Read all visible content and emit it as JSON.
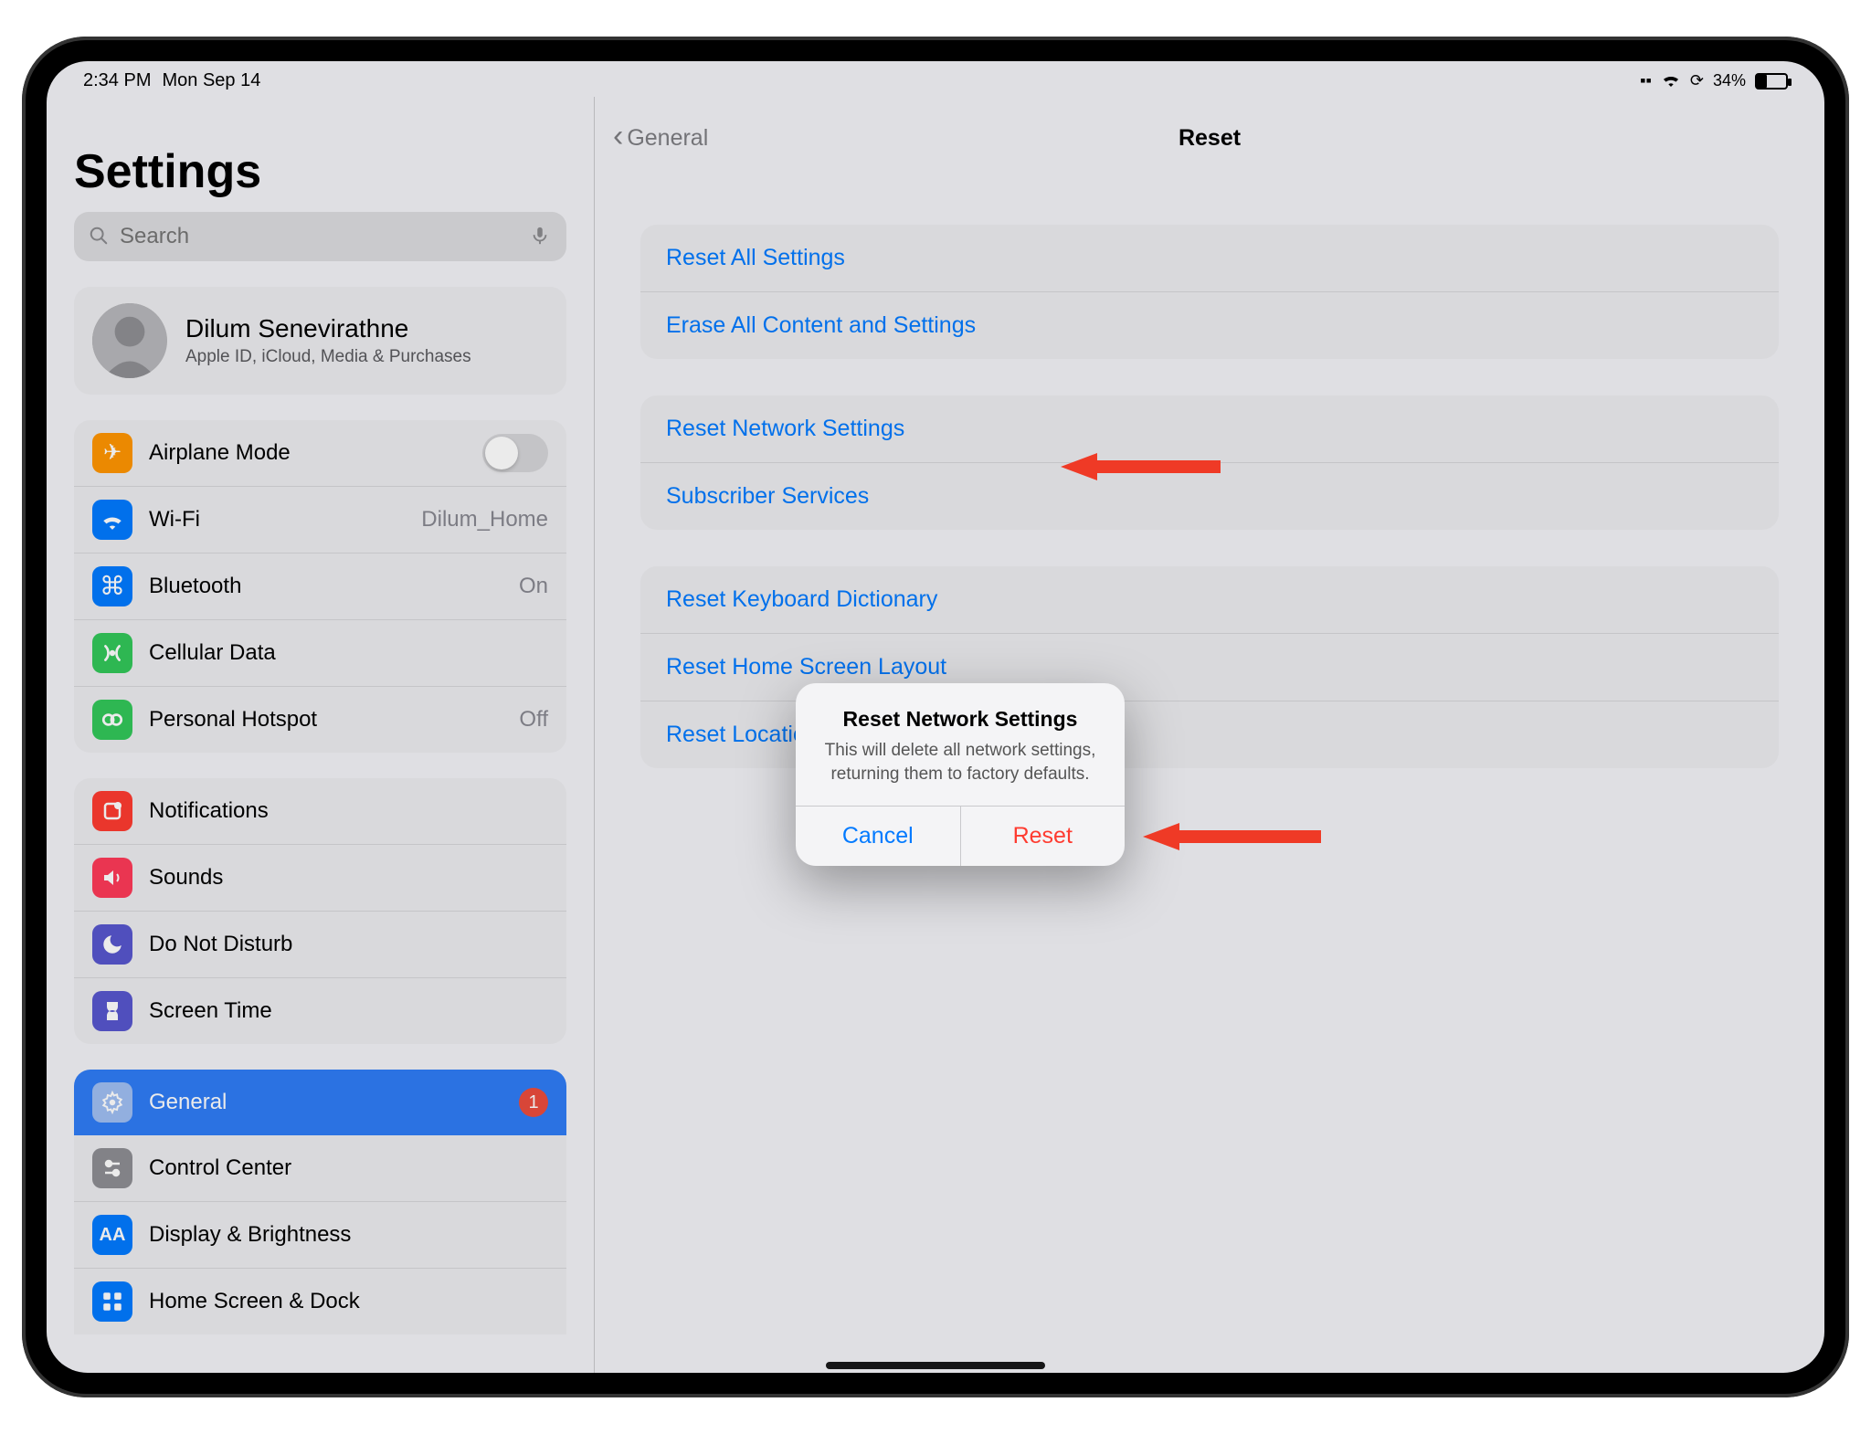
{
  "status": {
    "time": "2:34 PM",
    "date": "Mon Sep 14",
    "battery_pct": "34%"
  },
  "sidebar": {
    "title": "Settings",
    "search_placeholder": "Search",
    "profile": {
      "name": "Dilum Senevirathne",
      "subtitle": "Apple ID, iCloud, Media & Purchases"
    },
    "group1": {
      "airplane": "Airplane Mode",
      "wifi_label": "Wi-Fi",
      "wifi_value": "Dilum_Home",
      "bluetooth_label": "Bluetooth",
      "bluetooth_value": "On",
      "cellular": "Cellular Data",
      "hotspot_label": "Personal Hotspot",
      "hotspot_value": "Off"
    },
    "group2": {
      "notifications": "Notifications",
      "sounds": "Sounds",
      "dnd": "Do Not Disturb",
      "screentime": "Screen Time"
    },
    "group3": {
      "general": "General",
      "general_badge": "1",
      "controlcenter": "Control Center",
      "display": "Display & Brightness",
      "homescreen": "Home Screen & Dock"
    }
  },
  "main": {
    "back_label": "General",
    "title": "Reset",
    "g1": {
      "reset_all": "Reset All Settings",
      "erase": "Erase All Content and Settings"
    },
    "g2": {
      "reset_network": "Reset Network Settings",
      "subscriber": "Subscriber Services"
    },
    "g3": {
      "keyboard": "Reset Keyboard Dictionary",
      "homelayout": "Reset Home Screen Layout",
      "location": "Reset Location & Privacy"
    }
  },
  "dialog": {
    "title": "Reset Network Settings",
    "message": "This will delete all network settings, returning them to factory defaults.",
    "cancel": "Cancel",
    "confirm": "Reset"
  }
}
